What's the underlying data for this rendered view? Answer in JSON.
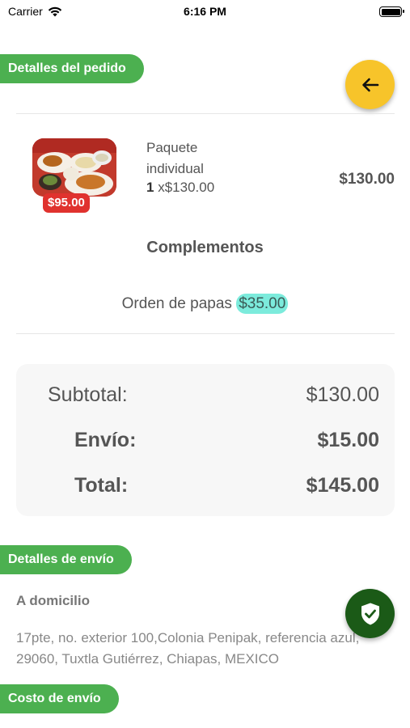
{
  "status_bar": {
    "carrier": "Carrier",
    "time": "6:16 PM"
  },
  "order_details": {
    "title": "Detalles del pedido",
    "product": {
      "name": "Paquete individual",
      "quantity": "1",
      "unit_price": "x$130.00",
      "total": "$130.00",
      "badge_price": "$95.00"
    },
    "complements_title": "Complementos",
    "complements": [
      {
        "label": "Orden de papas",
        "price": "$35.00"
      }
    ]
  },
  "summary": {
    "subtotal_label": "Subtotal:",
    "subtotal_value": "$130.00",
    "shipping_label": "Envío:",
    "shipping_value": "$15.00",
    "total_label": "Total:",
    "total_value": "$145.00"
  },
  "shipping_details": {
    "title": "Detalles de envío",
    "type": "A domicilio",
    "address": "17pte, no. exterior 100,Colonia Penipak, referencia azul, 29060, Tuxtla Gutiérrez, Chiapas, MEXICO"
  },
  "shipping_cost": {
    "title": "Costo de envío"
  },
  "icons": {
    "back": "arrow-left-icon",
    "confirm": "shield-check-icon"
  },
  "colors": {
    "green_pill": "#4cb050",
    "back_button": "#f7c42a",
    "shield_button": "#1b5a17",
    "badge_red": "#e0322e",
    "addon_highlight": "#7cebdc"
  }
}
